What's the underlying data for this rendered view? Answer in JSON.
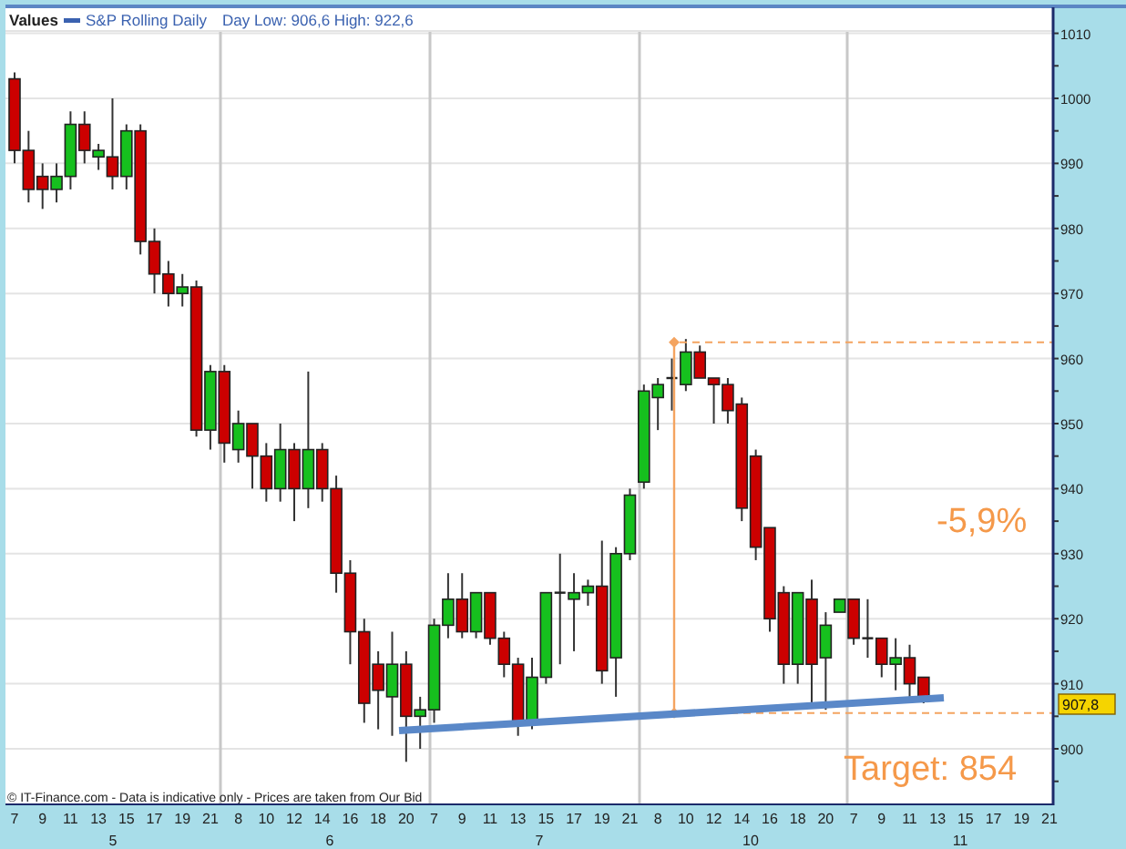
{
  "legend": {
    "title": "Values",
    "series": "S&P Rolling Daily",
    "info": "Day Low: 906,6 High: 922,6"
  },
  "price_tag": "907,8",
  "chart": {
    "chart_data": {
      "type": "candlestick",
      "ylim": [
        891.6,
        1014
      ],
      "grid": true,
      "yticks": [
        {
          "value": 1010,
          "label": "1010"
        },
        {
          "value": 1000,
          "label": "1000"
        },
        {
          "value": 990,
          "label": "990"
        },
        {
          "value": 980,
          "label": "980"
        },
        {
          "value": 970,
          "label": "970"
        },
        {
          "value": 960,
          "label": "960"
        },
        {
          "value": 950,
          "label": "950"
        },
        {
          "value": 940,
          "label": "940"
        },
        {
          "value": 930,
          "label": "930"
        },
        {
          "value": 920,
          "label": "920"
        },
        {
          "value": 910,
          "label": "910"
        },
        {
          "value": 900,
          "label": "900"
        }
      ],
      "categories": [
        "7",
        null,
        "9",
        null,
        "11",
        null,
        "13",
        null,
        "15",
        null,
        "17",
        null,
        "19",
        null,
        "21",
        null,
        "8",
        null,
        "10",
        null,
        "12",
        null,
        "14",
        null,
        "16",
        null,
        "18",
        null,
        "20",
        null,
        "7",
        null,
        "9",
        null,
        "11",
        null,
        "13",
        null,
        "15",
        null,
        "17",
        null,
        "19",
        null,
        "21",
        null,
        "8",
        null,
        "10",
        null,
        "12",
        null,
        "14",
        null,
        "16",
        null,
        "18",
        null,
        "20",
        null,
        "7",
        null,
        "9",
        null,
        "11",
        null,
        "13",
        null,
        "15",
        null,
        "17",
        null,
        "19",
        null,
        "21"
      ],
      "ohlc": [
        [
          1003,
          1004,
          990,
          992
        ],
        [
          992,
          995,
          984,
          986
        ],
        [
          988,
          990,
          983,
          986
        ],
        [
          986,
          990,
          984,
          988
        ],
        [
          988,
          998,
          986,
          996
        ],
        [
          996,
          998,
          990,
          992
        ],
        [
          991,
          993,
          989,
          992
        ],
        [
          991,
          1000,
          986,
          988
        ],
        [
          988,
          996,
          986,
          995
        ],
        [
          995,
          996,
          976,
          978
        ],
        [
          978,
          980,
          970,
          973
        ],
        [
          973,
          975,
          968,
          970
        ],
        [
          970,
          973,
          968,
          971
        ],
        [
          971,
          972,
          948,
          949
        ],
        [
          949,
          959,
          946,
          958
        ],
        [
          958,
          959,
          944,
          947
        ],
        [
          946,
          952,
          944,
          950
        ],
        [
          950,
          950,
          940,
          945
        ],
        [
          945,
          947,
          938,
          940
        ],
        [
          940,
          950,
          938,
          946
        ],
        [
          946,
          947,
          935,
          940
        ],
        [
          940,
          958,
          937,
          946
        ],
        [
          946,
          947,
          938,
          940
        ],
        [
          940,
          942,
          924,
          927
        ],
        [
          927,
          929,
          913,
          918
        ],
        [
          918,
          920,
          904,
          907
        ],
        [
          913,
          915,
          903,
          909
        ],
        [
          908,
          918,
          902,
          913
        ],
        [
          913,
          915,
          898,
          905
        ],
        [
          905,
          908,
          900,
          906
        ],
        [
          906,
          920,
          904,
          919
        ],
        [
          919,
          927,
          917,
          923
        ],
        [
          923,
          927,
          917,
          918
        ],
        [
          918,
          924,
          917,
          924
        ],
        [
          924,
          924,
          916,
          917
        ],
        [
          917,
          918,
          911,
          913
        ],
        [
          913,
          914,
          902,
          904
        ],
        [
          904,
          914,
          903,
          911
        ],
        [
          911,
          924,
          910,
          924
        ],
        [
          924,
          930,
          913,
          924
        ],
        [
          923,
          927,
          915,
          924
        ],
        [
          924,
          926,
          922,
          925
        ],
        [
          925,
          932,
          910,
          912
        ],
        [
          914,
          931,
          908,
          930
        ],
        [
          930,
          940,
          929,
          939
        ],
        [
          941,
          956,
          940,
          955
        ],
        [
          954,
          957,
          949,
          956
        ],
        [
          957,
          960,
          952,
          957
        ],
        [
          956,
          963,
          955,
          961
        ],
        [
          961,
          962,
          957,
          957
        ],
        [
          957,
          957,
          950,
          956
        ],
        [
          956,
          957,
          950,
          952
        ],
        [
          953,
          954,
          935,
          937
        ],
        [
          945,
          946,
          929,
          931
        ],
        [
          934,
          934,
          918,
          920
        ],
        [
          924,
          925,
          910,
          913
        ],
        [
          913,
          924,
          910,
          924
        ],
        [
          923,
          926,
          907,
          913
        ],
        [
          914,
          921,
          906,
          919
        ],
        [
          921,
          923,
          921,
          923
        ],
        [
          923,
          923,
          916,
          917
        ],
        [
          917,
          923,
          914,
          917
        ],
        [
          917,
          917,
          911,
          913
        ],
        [
          913,
          917,
          909,
          914
        ],
        [
          914,
          916,
          908,
          910
        ],
        [
          911,
          911,
          907,
          908
        ],
        null,
        null,
        null,
        null,
        null,
        null,
        null,
        null,
        null
      ]
    },
    "annotations": {
      "change": "-5,9%",
      "target": "Target: 854"
    }
  },
  "footer": "© IT-Finance.com - Data is indicative only - Prices are taken from Our Bid",
  "x_axis_days": [
    "5",
    "6",
    "7",
    "10",
    "11"
  ]
}
